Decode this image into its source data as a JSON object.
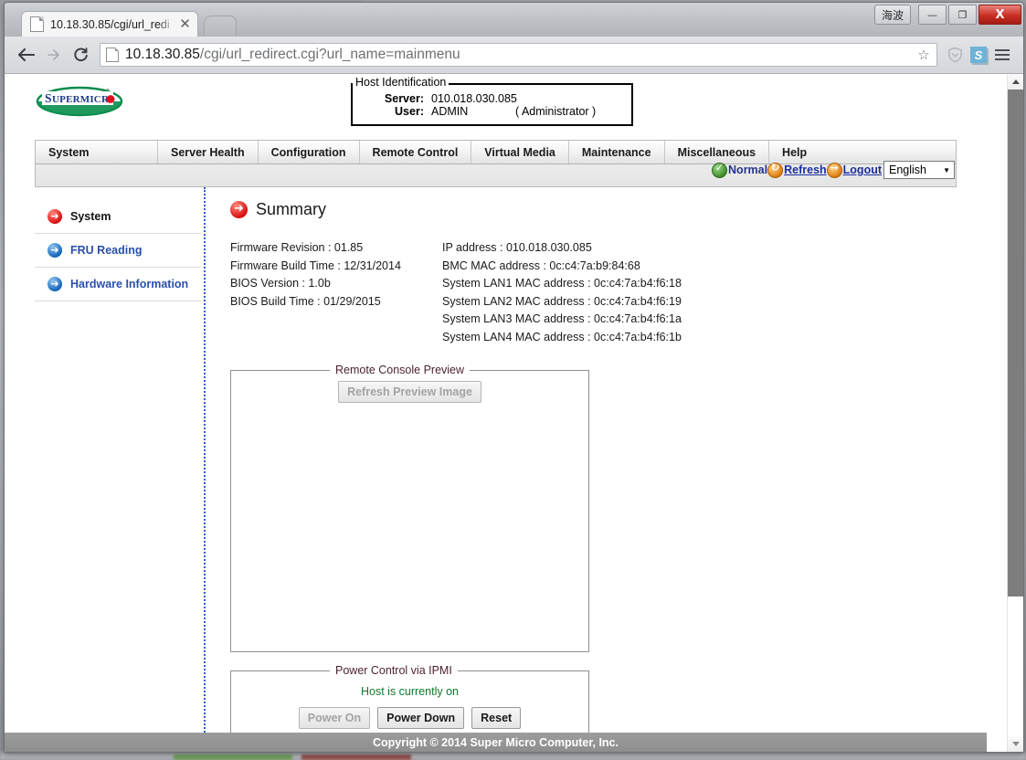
{
  "window": {
    "user_chip": "海波",
    "minimize": "—",
    "maximize": "❐",
    "close": "X"
  },
  "browser": {
    "tab_title": "10.18.30.85/cgi/url_redi",
    "tab_close": "✕",
    "back_icon": "←",
    "forward_icon": "→",
    "reload_icon": "C",
    "url_host": "10.18.30.85",
    "url_path": "/cgi/url_redirect.cgi?url_name=mainmenu",
    "star_icon": "☆",
    "shield_icon": "shield",
    "extension_label": "S",
    "menu_icon": "hamburger"
  },
  "ipmi": {
    "logo_text": "SUPERMICRO",
    "host_identification": {
      "legend": "Host Identification",
      "server_label": "Server:",
      "server_value": "010.018.030.085",
      "user_label": "User:",
      "user_value": "ADMIN",
      "user_role": "( Administrator )"
    },
    "status": {
      "state_label": "Normal",
      "refresh_label": "Refresh",
      "logout_label": "Logout",
      "language": "English",
      "caret": "▼",
      "state_color": "#3f8f2b",
      "action_color": "#e07c10"
    },
    "nav": [
      {
        "label": "System"
      },
      {
        "label": "Server Health"
      },
      {
        "label": "Configuration"
      },
      {
        "label": "Remote Control"
      },
      {
        "label": "Virtual Media"
      },
      {
        "label": "Maintenance"
      },
      {
        "label": "Miscellaneous"
      },
      {
        "label": "Help"
      }
    ],
    "sidebar": [
      {
        "label": "System",
        "style": "active"
      },
      {
        "label": "FRU Reading",
        "style": "link"
      },
      {
        "label": "Hardware Information",
        "style": "link"
      }
    ],
    "page_title": "Summary",
    "info_left": [
      "Firmware Revision : 01.85",
      "Firmware Build Time : 12/31/2014",
      "BIOS Version : 1.0b",
      "BIOS Build Time : 01/29/2015"
    ],
    "info_right": [
      "IP address : 010.018.030.085",
      "BMC MAC address : 0c:c4:7a:b9:84:68",
      "System LAN1 MAC address : 0c:c4:7a:b4:f6:18",
      "System LAN2 MAC address : 0c:c4:7a:b4:f6:19",
      "System LAN3 MAC address : 0c:c4:7a:b4:f6:1a",
      "System LAN4 MAC address : 0c:c4:7a:b4:f6:1b"
    ],
    "remote_console": {
      "legend": "Remote Console Preview",
      "refresh_button": "Refresh Preview Image"
    },
    "power_control": {
      "legend": "Power Control via IPMI",
      "status_text": "Host is currently on",
      "status_color": "#0e7a2c",
      "power_on": "Power On",
      "power_down": "Power Down",
      "reset": "Reset"
    },
    "footer": "Copyright © 2014 Super Micro Computer, Inc."
  }
}
